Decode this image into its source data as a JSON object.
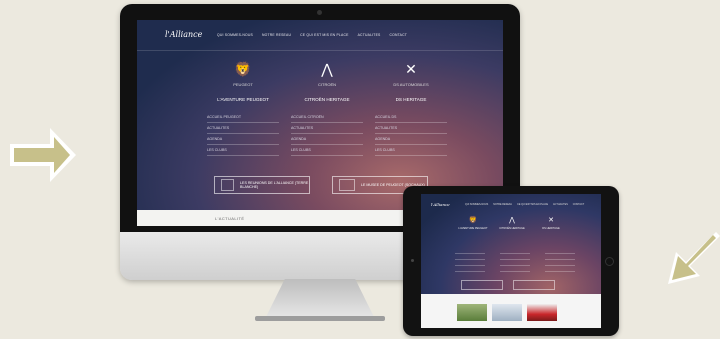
{
  "site": {
    "logo": "l'Alliance",
    "nav": [
      "QUI SOMMES-NOUS",
      "NOTRE RESEAU",
      "CE QUI EST MIS EN PLACE",
      "ACTUALITES",
      "CONTACT"
    ]
  },
  "brands": [
    {
      "name": "PEUGEOT",
      "title": "L'AVENTURE PEUGEOT",
      "mark": "🦁",
      "links": [
        "ACCUEIL PEUGEOT",
        "ACTUALITES",
        "AGENDA",
        "LES CLUBS"
      ]
    },
    {
      "name": "CITROËN",
      "title": "CITROËN HERITAGE",
      "mark": "⋀",
      "links": [
        "ACCUEIL CITROËN",
        "ACTUALITES",
        "AGENDA",
        "LES CLUBS"
      ]
    },
    {
      "name": "DS AUTOMOBILES",
      "title": "DS HERITAGE",
      "mark": "✕",
      "links": [
        "ACCUEIL DS",
        "ACTUALITES",
        "AGENDA",
        "LES CLUBS"
      ]
    }
  ],
  "promos": [
    {
      "text": "LES REUNIONS DE L'ALLIANCE (TERRE BLANCHE)"
    },
    {
      "text": "LE MUSEE DE PEUGEOT (SOCHAUX)"
    }
  ],
  "actualite_label": "L'ACTUALITÉ",
  "device_colors": {
    "arrow": "#c7c08a",
    "background": "#ece9df"
  }
}
